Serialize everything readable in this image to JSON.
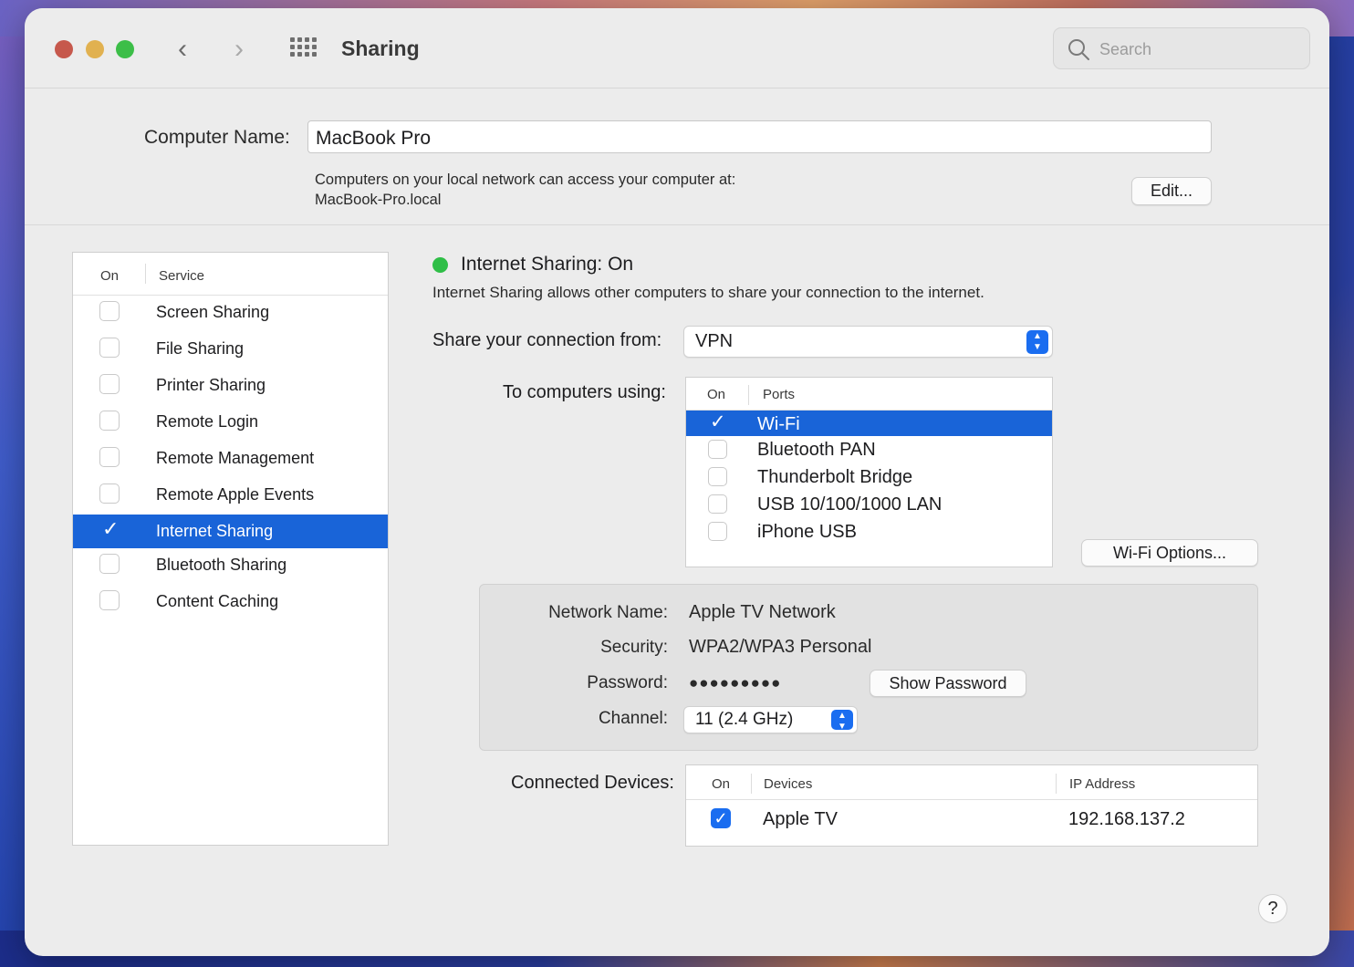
{
  "window": {
    "title": "Sharing"
  },
  "toolbar": {
    "search_placeholder": "Search"
  },
  "computer_name": {
    "label": "Computer Name:",
    "value": "MacBook Pro",
    "desc_line1": "Computers on your local network can access your computer at:",
    "desc_line2": "MacBook-Pro.local",
    "edit_button": "Edit..."
  },
  "services": {
    "header_on": "On",
    "header_service": "Service",
    "items": [
      {
        "label": "Screen Sharing",
        "checked": false
      },
      {
        "label": "File Sharing",
        "checked": false
      },
      {
        "label": "Printer Sharing",
        "checked": false
      },
      {
        "label": "Remote Login",
        "checked": false
      },
      {
        "label": "Remote Management",
        "checked": false
      },
      {
        "label": "Remote Apple Events",
        "checked": false
      },
      {
        "label": "Internet Sharing",
        "checked": true,
        "selected": true
      },
      {
        "label": "Bluetooth Sharing",
        "checked": false
      },
      {
        "label": "Content Caching",
        "checked": false
      }
    ]
  },
  "internet_sharing": {
    "status": "Internet Sharing:  On",
    "status_color": "#2fbe47",
    "description": "Internet Sharing allows other computers to share your connection to the internet.",
    "share_from_label": "Share your connection from:",
    "share_from_value": "VPN",
    "to_computers_label": "To computers using:",
    "ports_header_on": "On",
    "ports_header_ports": "Ports",
    "ports": [
      {
        "label": "Wi-Fi",
        "checked": true,
        "selected": true
      },
      {
        "label": "Bluetooth PAN",
        "checked": false
      },
      {
        "label": "Thunderbolt Bridge",
        "checked": false
      },
      {
        "label": "USB 10/100/1000 LAN",
        "checked": false
      },
      {
        "label": "iPhone USB",
        "checked": false
      }
    ],
    "wifi_options_button": "Wi-Fi Options..."
  },
  "network": {
    "name_label": "Network Name:",
    "name_value": "Apple TV Network",
    "security_label": "Security:",
    "security_value": "WPA2/WPA3 Personal",
    "password_label": "Password:",
    "password_value": "●●●●●●●●●",
    "show_password_button": "Show Password",
    "channel_label": "Channel:",
    "channel_value": "11 (2.4 GHz)"
  },
  "devices": {
    "label": "Connected Devices:",
    "header_on": "On",
    "header_devices": "Devices",
    "header_ip": "IP Address",
    "items": [
      {
        "name": "Apple TV",
        "ip": "192.168.137.2",
        "checked": true
      }
    ]
  },
  "help": "?",
  "accent_color": "#1964d8"
}
